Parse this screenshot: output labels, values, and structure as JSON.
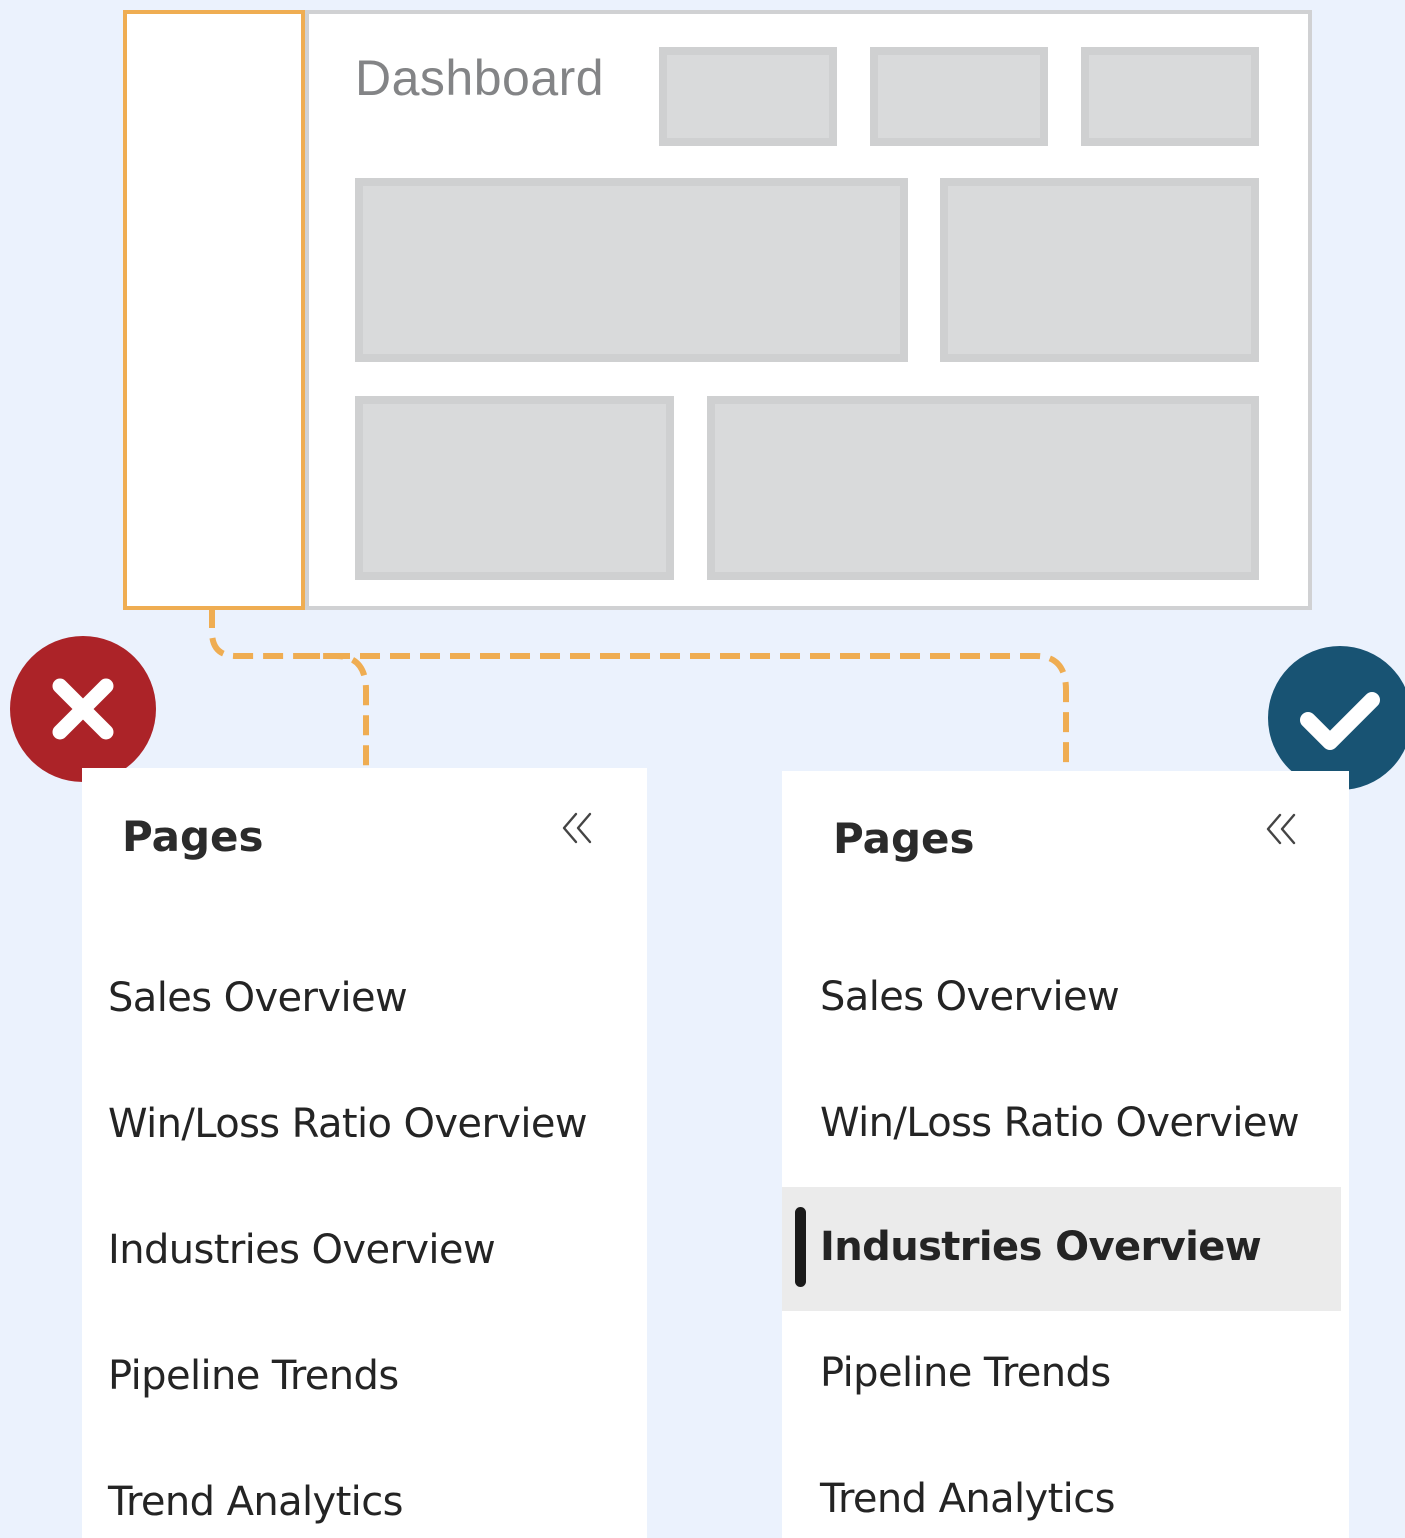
{
  "dashboard": {
    "title": "Dashboard"
  },
  "colors": {
    "background": "#ebf2fd",
    "highlight_outline": "#efad52",
    "connector": "#efad52",
    "tile_fill": "#d9dadb",
    "wrong_badge": "#ac2328",
    "right_badge": "#185373",
    "selected_item_bg": "#ebebeb"
  },
  "left_panel": {
    "verdict": "incorrect",
    "verdict_icon": "x-mark-icon",
    "title": "Pages",
    "collapse_icon": "double-chevron-left-icon",
    "items": [
      {
        "label": "Sales Overview",
        "selected": false
      },
      {
        "label": "Win/Loss Ratio Overview",
        "selected": false
      },
      {
        "label": "Industries Overview",
        "selected": false
      },
      {
        "label": "Pipeline Trends",
        "selected": false
      },
      {
        "label": "Trend Analytics",
        "selected": false
      }
    ]
  },
  "right_panel": {
    "verdict": "correct",
    "verdict_icon": "check-mark-icon",
    "title": "Pages",
    "collapse_icon": "double-chevron-left-icon",
    "items": [
      {
        "label": "Sales Overview",
        "selected": false
      },
      {
        "label": "Win/Loss Ratio Overview",
        "selected": false
      },
      {
        "label": "Industries Overview",
        "selected": true
      },
      {
        "label": "Pipeline Trends",
        "selected": false
      },
      {
        "label": "Trend Analytics",
        "selected": false
      }
    ]
  }
}
